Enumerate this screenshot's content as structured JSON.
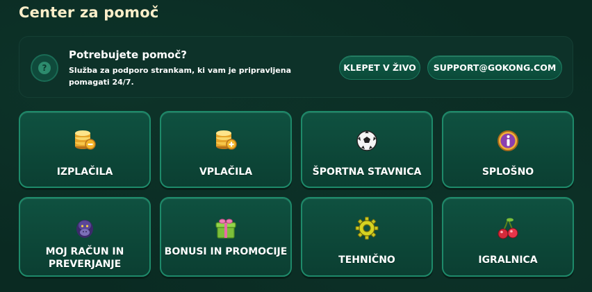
{
  "page": {
    "title": "Center za pomoč"
  },
  "help": {
    "title": "Potrebujete pomoč?",
    "description": "Služba za podporo strankam, ki vam je pripravljena pomagati 24/7.",
    "icon": "question-icon",
    "chat_label": "KLEPET V ŽIVO",
    "email_label": "SUPPORT@GOKONG.COM"
  },
  "categories": [
    {
      "label": "IZPLAČILA",
      "icon": "coins-minus-icon"
    },
    {
      "label": "VPLAČILA",
      "icon": "coins-plus-icon"
    },
    {
      "label": "ŠPORTNA STAVNICA",
      "icon": "soccer-ball-icon"
    },
    {
      "label": "SPLOŠNO",
      "icon": "info-icon"
    },
    {
      "label": "MOJ RAČUN IN PREVERJANJE",
      "icon": "gorilla-icon"
    },
    {
      "label": "BONUSI IN PROMOCIJE",
      "icon": "gift-icon"
    },
    {
      "label": "TEHNIČNO",
      "icon": "gear-icon"
    },
    {
      "label": "IGRALNICA",
      "icon": "cherries-icon"
    }
  ],
  "colors": {
    "background": "#0a2a22",
    "card": "#0f5140",
    "card_border": "#1e8a6a",
    "title": "#fbeec9"
  }
}
